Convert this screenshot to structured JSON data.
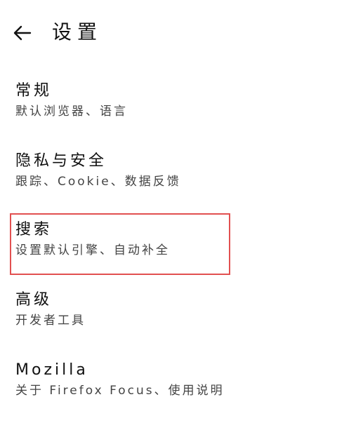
{
  "header": {
    "title": "设置"
  },
  "settings": {
    "items": [
      {
        "label": "常规",
        "description": "默认浏览器、语言"
      },
      {
        "label": "隐私与安全",
        "description": "跟踪、Cookie、数据反馈"
      },
      {
        "label": "搜索",
        "description": "设置默认引擎、自动补全"
      },
      {
        "label": "高级",
        "description": "开发者工具"
      },
      {
        "label": "Mozilla",
        "description": "关于 Firefox Focus、使用说明"
      }
    ]
  },
  "colors": {
    "highlight_border": "#e25050",
    "text_primary": "#111111",
    "text_secondary": "#444444",
    "background": "#ffffff"
  }
}
